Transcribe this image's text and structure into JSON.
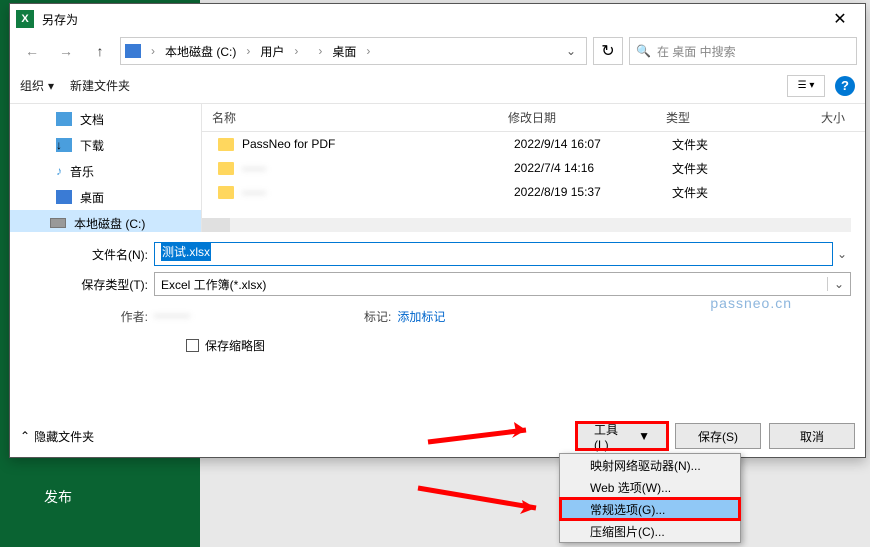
{
  "bg": {
    "publish": "发布"
  },
  "dialog": {
    "title": "另存为",
    "breadcrumb": {
      "items": [
        "本地磁盘 (C:)",
        "用户",
        "",
        "桌面"
      ]
    },
    "search_placeholder": "在 桌面 中搜索",
    "toolbar": {
      "organize": "组织",
      "newfolder": "新建文件夹"
    },
    "nav": {
      "documents": "文档",
      "downloads": "下载",
      "music": "音乐",
      "desktop": "桌面",
      "localdisk": "本地磁盘 (C:)"
    },
    "columns": {
      "name": "名称",
      "date": "修改日期",
      "type": "类型",
      "size": "大小"
    },
    "rows": [
      {
        "name": "PassNeo for PDF",
        "date": "2022/9/14 16:07",
        "type": "文件夹"
      },
      {
        "name": "——",
        "date": "2022/7/4 14:16",
        "type": "文件夹"
      },
      {
        "name": "——",
        "date": "2022/8/19 15:37",
        "type": "文件夹"
      }
    ],
    "filename_label": "文件名(N):",
    "filename_value": "测试.xlsx",
    "filetype_label": "保存类型(T):",
    "filetype_value": "Excel 工作簿(*.xlsx)",
    "author_label": "作者:",
    "tag_label": "标记:",
    "tag_value": "添加标记",
    "thumb_label": "保存缩略图",
    "hide_folders": "隐藏文件夹",
    "buttons": {
      "tools": "工具(L)",
      "save": "保存(S)",
      "cancel": "取消"
    }
  },
  "menu": {
    "items": [
      "映射网络驱动器(N)...",
      "Web 选项(W)...",
      "常规选项(G)...",
      "压缩图片(C)..."
    ]
  },
  "watermark": "passneo.cn"
}
